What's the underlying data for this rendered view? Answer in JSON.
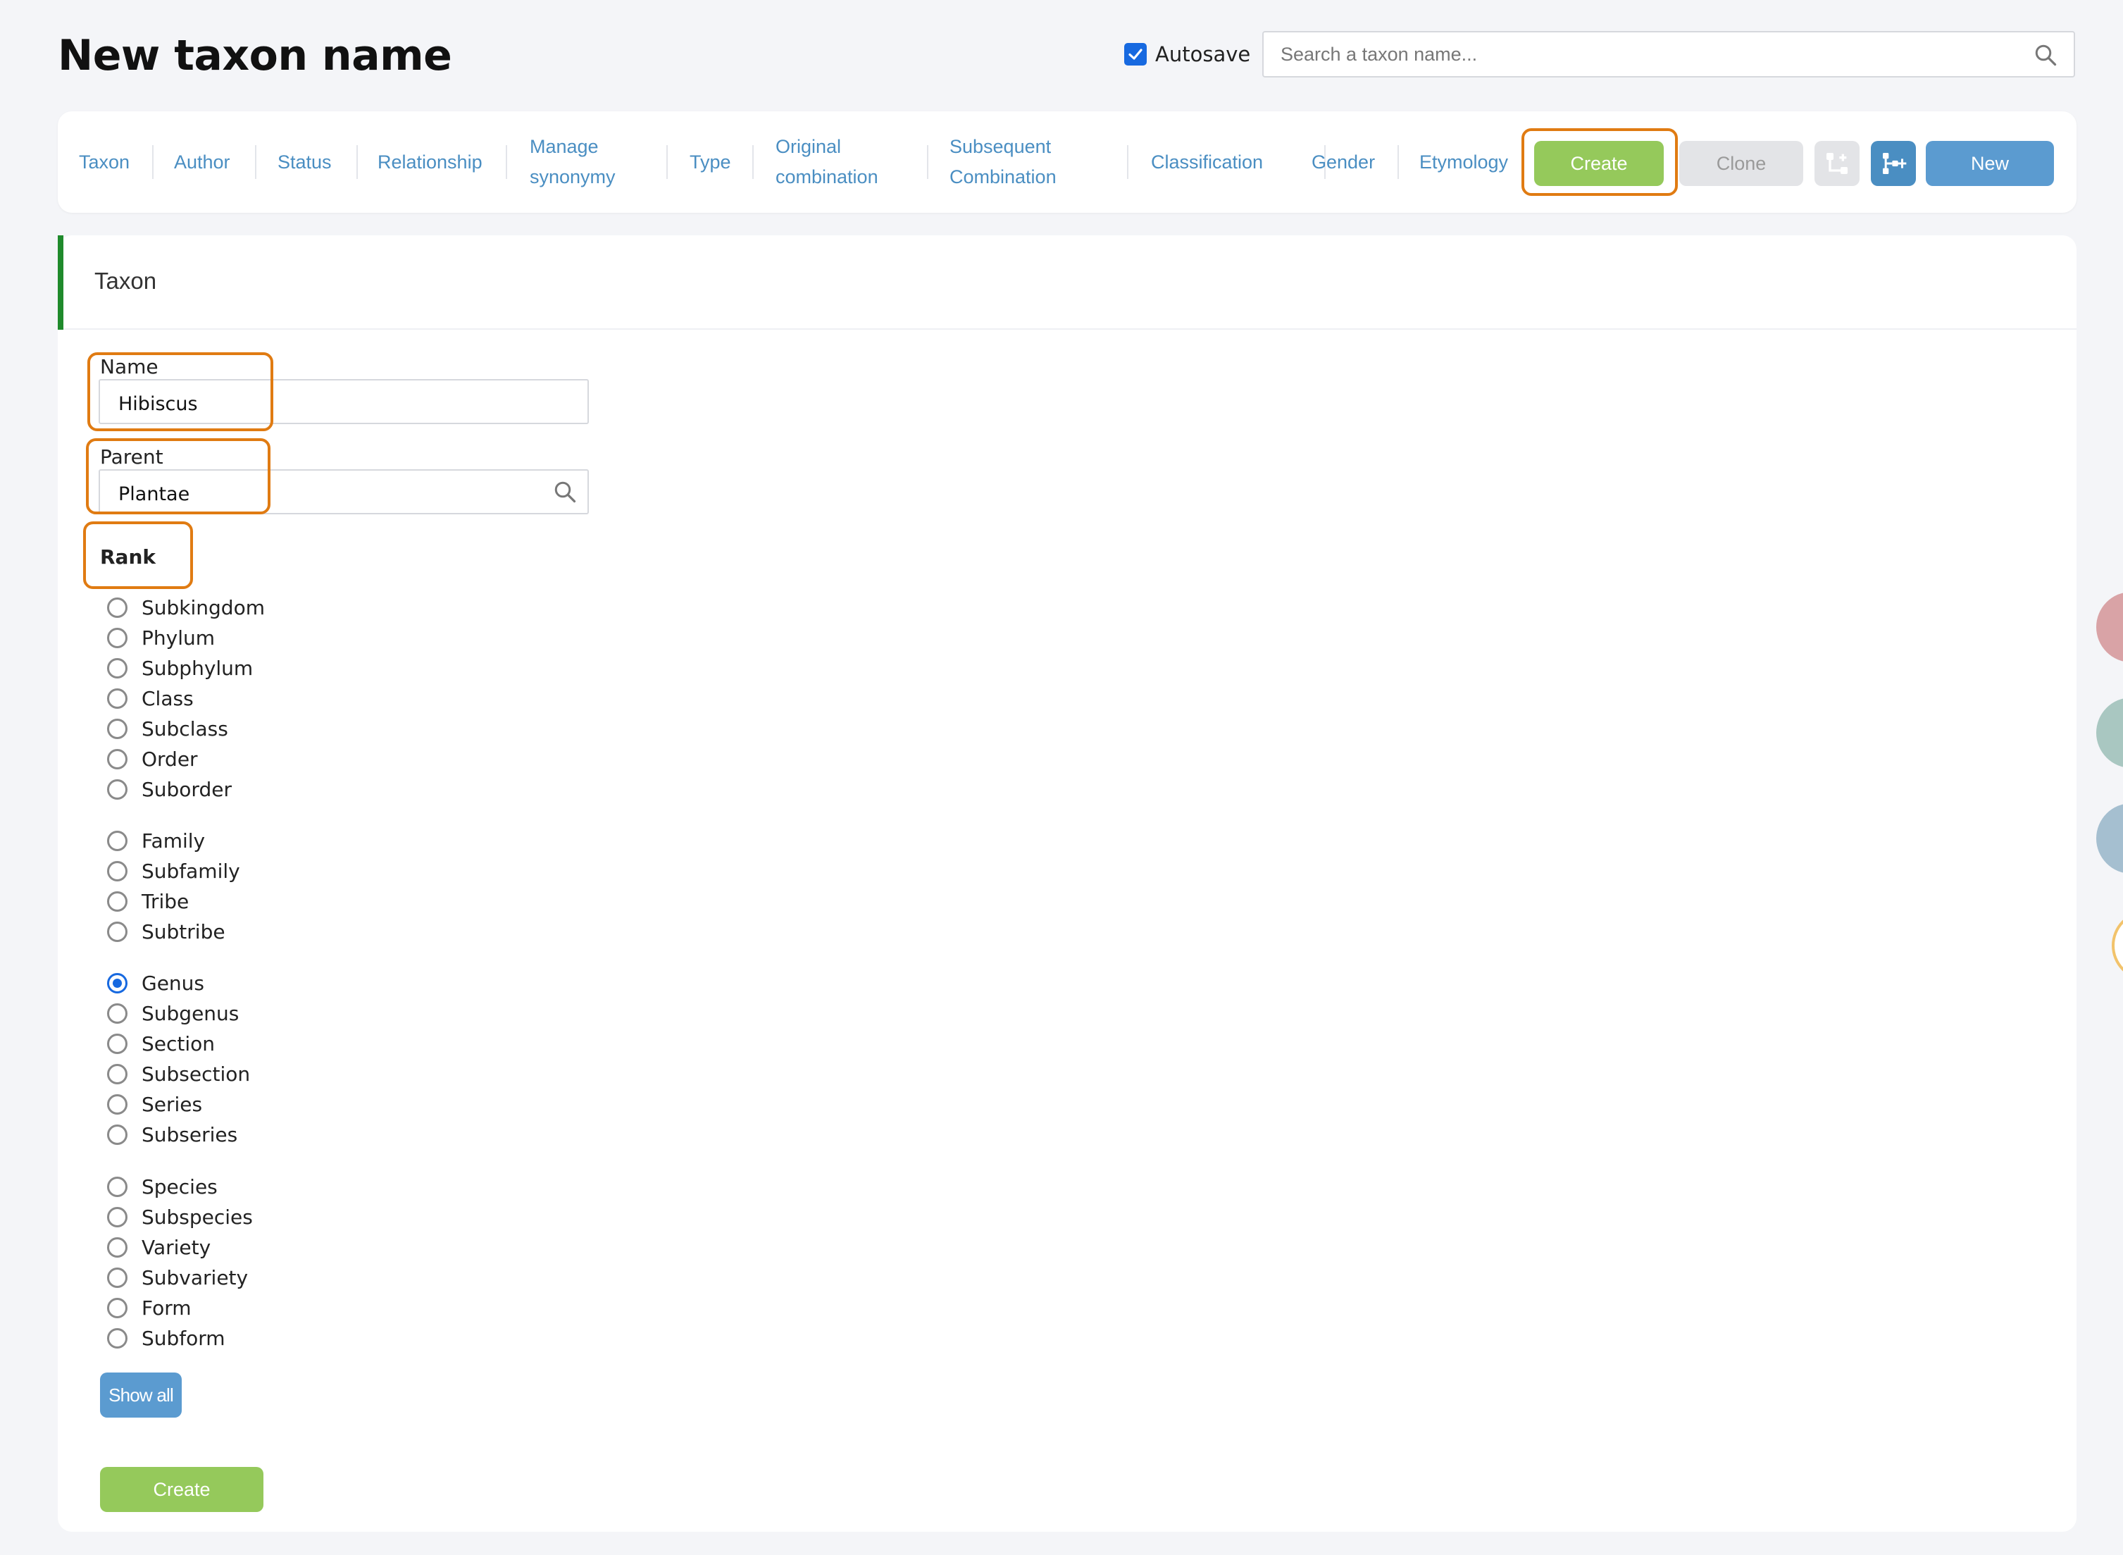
{
  "header": {
    "title": "New taxon name",
    "autosave_label": "Autosave",
    "autosave_checked": true,
    "search_placeholder": "Search a taxon name..."
  },
  "nav": {
    "items": [
      {
        "lines": [
          "Taxon"
        ]
      },
      {
        "lines": [
          "Author"
        ]
      },
      {
        "lines": [
          "Status"
        ]
      },
      {
        "lines": [
          "Relationship"
        ]
      },
      {
        "lines": [
          "Manage",
          "synonymy"
        ]
      },
      {
        "lines": [
          "Type"
        ]
      },
      {
        "lines": [
          "Original",
          "combination"
        ]
      },
      {
        "lines": [
          "Subsequent",
          "Combination"
        ]
      },
      {
        "lines": [
          "Classification"
        ]
      },
      {
        "lines": [
          "Gender"
        ]
      },
      {
        "lines": [
          "Etymology"
        ]
      }
    ],
    "create_label": "Create",
    "clone_label": "Clone",
    "new_label": "New"
  },
  "panel": {
    "title": "Taxon",
    "name_label": "Name",
    "name_value": "Hibiscus",
    "parent_label": "Parent",
    "parent_value": "Plantae",
    "rank_label": "Rank",
    "rank_groups": [
      [
        "Subkingdom",
        "Phylum",
        "Subphylum",
        "Class",
        "Subclass",
        "Order",
        "Suborder"
      ],
      [
        "Family",
        "Subfamily",
        "Tribe",
        "Subtribe"
      ],
      [
        "Genus",
        "Subgenus",
        "Section",
        "Subsection",
        "Series",
        "Subseries"
      ],
      [
        "Species",
        "Subspecies",
        "Variety",
        "Subvariety",
        "Form",
        "Subform"
      ]
    ],
    "selected_rank": "Genus",
    "show_all_label": "Show all",
    "create_label": "Create"
  },
  "colors": {
    "accent_green": "#95c95b",
    "accent_blue": "#5b9bd0",
    "nav_link": "#4a8ec2",
    "highlight": "#e07b12",
    "section_bar": "#1f8a2c"
  }
}
